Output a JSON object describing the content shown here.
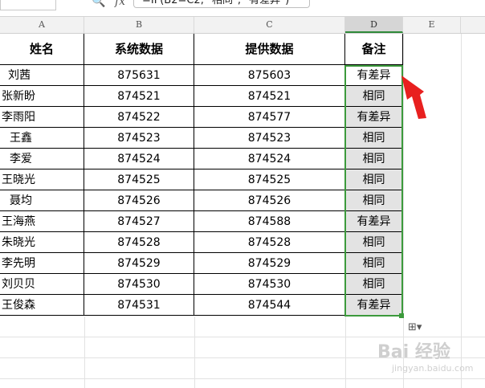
{
  "formula_bar": {
    "formula": "=IF(B2=C2, \"相同\", \"有差异\")"
  },
  "column_headers": [
    "A",
    "B",
    "C",
    "D",
    "E"
  ],
  "table": {
    "headers": [
      "姓名",
      "系统数据",
      "提供数据",
      "备注"
    ],
    "rows": [
      [
        "刘茜",
        "875631",
        "875603",
        "有差异"
      ],
      [
        "张新盼",
        "874521",
        "874521",
        "相同"
      ],
      [
        "李雨阳",
        "874522",
        "874577",
        "有差异"
      ],
      [
        "王鑫",
        "874523",
        "874523",
        "相同"
      ],
      [
        "李爱",
        "874524",
        "874524",
        "相同"
      ],
      [
        "王晓光",
        "874525",
        "874525",
        "相同"
      ],
      [
        "聂均",
        "874526",
        "874526",
        "相同"
      ],
      [
        "王海燕",
        "874527",
        "874588",
        "有差异"
      ],
      [
        "朱晓光",
        "874528",
        "874528",
        "相同"
      ],
      [
        "李先明",
        "874529",
        "874529",
        "相同"
      ],
      [
        "刘贝贝",
        "874530",
        "874530",
        "相同"
      ],
      [
        "王俊森",
        "874531",
        "874544",
        "有差异"
      ]
    ]
  },
  "watermark": "Bai 经验",
  "watermark_sub": "jingyan.baidu.com",
  "colors": {
    "selection": "#3c9a3c",
    "arrow": "#e8201f"
  }
}
